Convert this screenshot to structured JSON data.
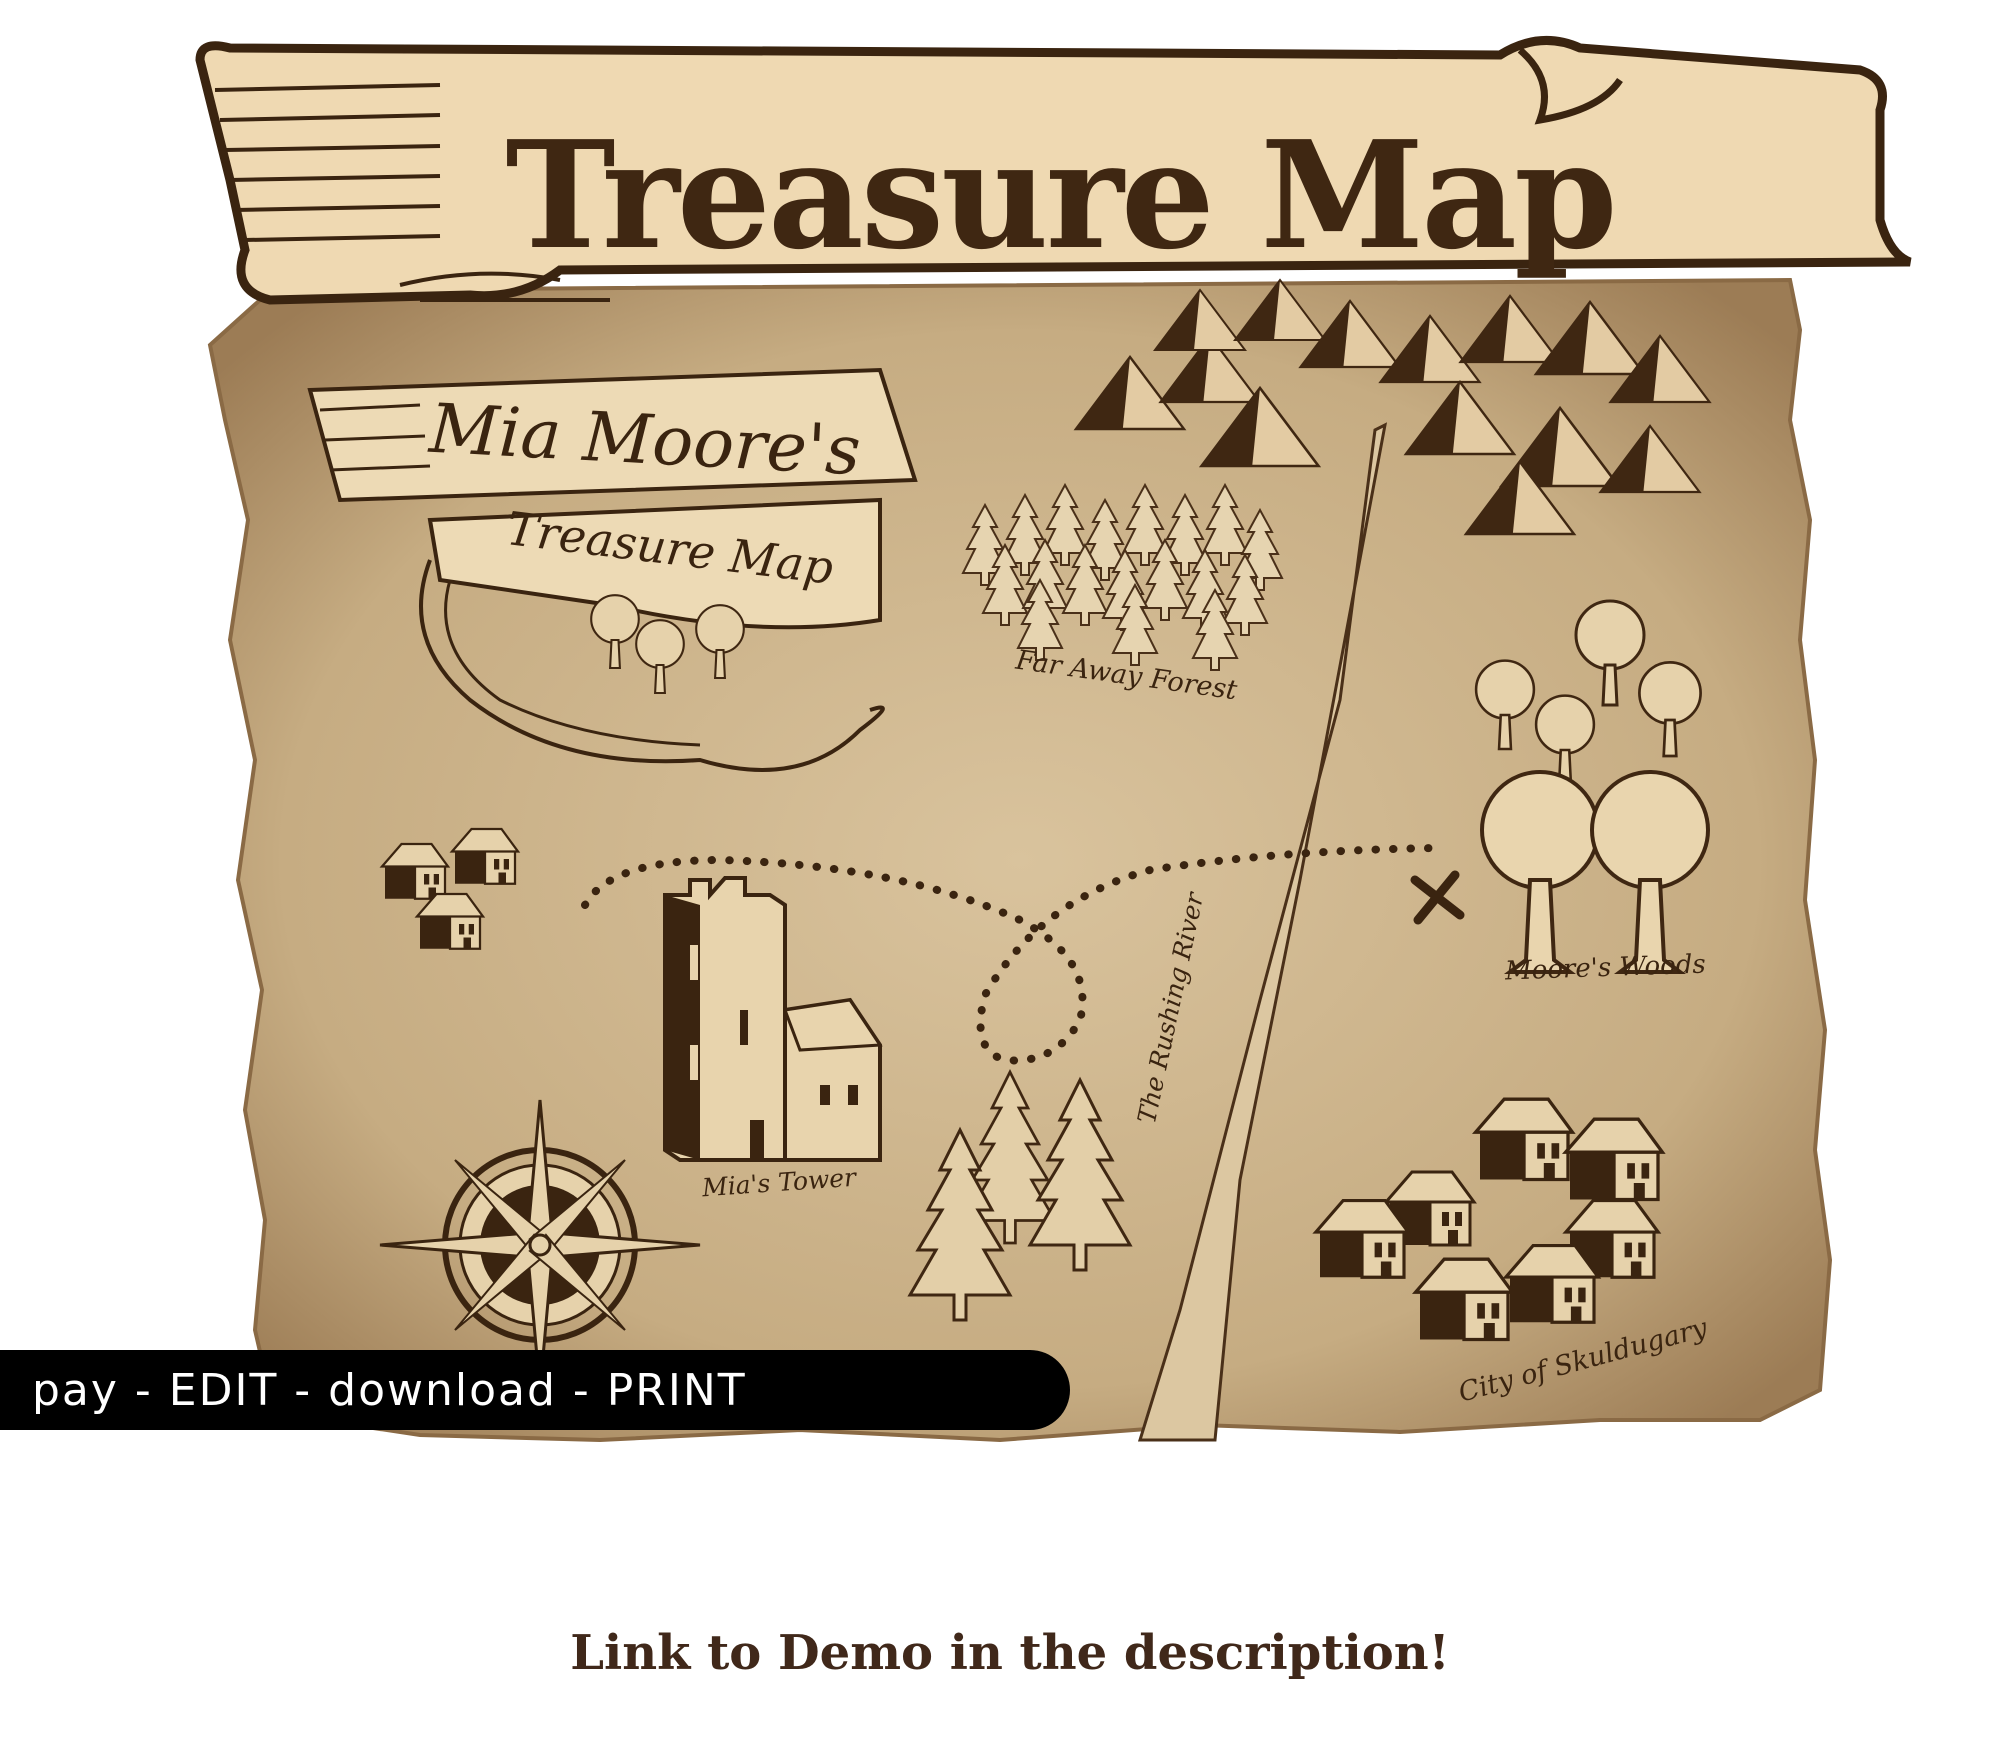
{
  "banner": {
    "title": "Treasure Map"
  },
  "map": {
    "name_line": "Mia Moore's",
    "subtitle_line": "Treasure Map",
    "places": {
      "forest": "Far Away Forest",
      "woods": "Moore's Woods",
      "tower": "Mia's Tower",
      "river": "The Rushing River",
      "city": "City of Skuldugary"
    },
    "icons": [
      "mountain-range-icon",
      "pine-forest-icon",
      "oak-trees-icon",
      "houses-icon",
      "tower-icon",
      "compass-rose-icon",
      "x-mark-icon",
      "dotted-path-icon"
    ]
  },
  "action_bar": {
    "text": "pay - EDIT - download - PRINT"
  },
  "footer": {
    "link_text": "Link to Demo in the description!"
  },
  "colors": {
    "parchment": "#c9b189",
    "ink": "#3f2712",
    "banner": "#efd9b2",
    "bar": "#000000"
  }
}
